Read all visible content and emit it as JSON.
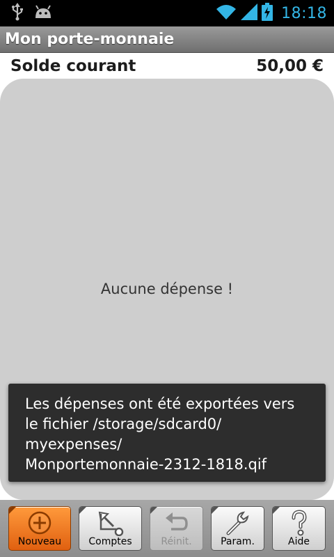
{
  "status_bar": {
    "time": "18:18",
    "icons": [
      "usb-icon",
      "android-debug-icon",
      "wifi-icon",
      "signal-icon",
      "battery-charging-icon"
    ],
    "time_color": "#33b5e5"
  },
  "app": {
    "title": "Mon porte-monnaie"
  },
  "balance": {
    "label": "Solde courant",
    "value": "50,00 €"
  },
  "list": {
    "empty_text": "Aucune dépense !"
  },
  "toast": {
    "message": "Les dépenses ont été exportées vers\nle fichier /storage/sdcard0/\nmyexpenses/\nMonportemonnaie-2312-1818.qif"
  },
  "toolbar": {
    "buttons": [
      {
        "label": "Nouveau",
        "icon": "add-icon",
        "state": "active"
      },
      {
        "label": "Comptes",
        "icon": "accounts-icon",
        "state": "enabled"
      },
      {
        "label": "Réinit.",
        "icon": "undo-icon",
        "state": "disabled"
      },
      {
        "label": "Param.",
        "icon": "wrench-icon",
        "state": "enabled"
      },
      {
        "label": "Aide",
        "icon": "help-icon",
        "state": "enabled"
      }
    ]
  },
  "colors": {
    "accent_orange": "#f07820",
    "panel_gray": "#cecece",
    "toast_bg": "#2d2d2d"
  }
}
